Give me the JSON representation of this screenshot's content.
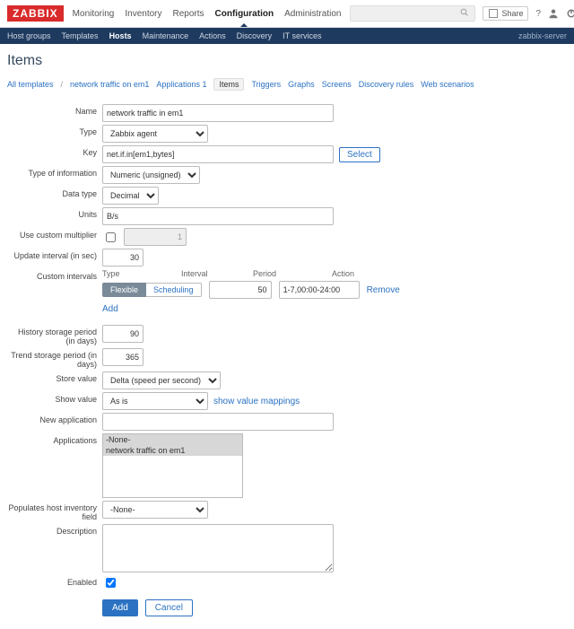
{
  "brand": "ZABBIX",
  "top_menu": [
    "Monitoring",
    "Inventory",
    "Reports",
    "Configuration",
    "Administration"
  ],
  "top_menu_selected": 3,
  "share": "Share",
  "server_name": "zabbix-server",
  "sub_menu": [
    "Host groups",
    "Templates",
    "Hosts",
    "Maintenance",
    "Actions",
    "Discovery",
    "IT services"
  ],
  "sub_menu_selected": 2,
  "page_title": "Items",
  "crumbs": {
    "all_templates": "All templates",
    "template": "network traffic on em1",
    "applications": "Applications 1",
    "items": "Items",
    "triggers": "Triggers",
    "graphs": "Graphs",
    "screens": "Screens",
    "discovery": "Discovery rules",
    "web": "Web scenarios"
  },
  "labels": {
    "name": "Name",
    "type": "Type",
    "key": "Key",
    "type_info": "Type of information",
    "data_type": "Data type",
    "units": "Units",
    "use_mult": "Use custom multiplier",
    "upd_int": "Update interval (in sec)",
    "cust_int": "Custom intervals",
    "history": "History storage period (in days)",
    "trend": "Trend storage period (in days)",
    "store": "Store value",
    "show": "Show value",
    "newapp": "New application",
    "apps": "Applications",
    "inv": "Populates host inventory field",
    "desc": "Description",
    "enabled": "Enabled"
  },
  "ci": {
    "type": "Type",
    "interval": "Interval",
    "period": "Period",
    "action": "Action",
    "flexible": "Flexible",
    "scheduling": "Scheduling",
    "interval_val": "50",
    "period_val": "1-7,00:00-24:00",
    "remove": "Remove",
    "add": "Add"
  },
  "values": {
    "name": "network traffic in em1",
    "type": "Zabbix agent",
    "key": "net.if.in[em1,bytes]",
    "select": "Select",
    "type_info": "Numeric (unsigned)",
    "data_type": "Decimal",
    "units": "B/s",
    "mult_checked": false,
    "mult_val": "1",
    "upd_int": "30",
    "history": "90",
    "trend": "365",
    "store": "Delta (speed per second)",
    "show": "As is",
    "show_link": "show value mappings",
    "newapp": "",
    "apps": [
      "-None-",
      "network traffic on em1"
    ],
    "inv": "-None-",
    "desc": "",
    "enabled": true
  },
  "buttons": {
    "add": "Add",
    "cancel": "Cancel"
  }
}
